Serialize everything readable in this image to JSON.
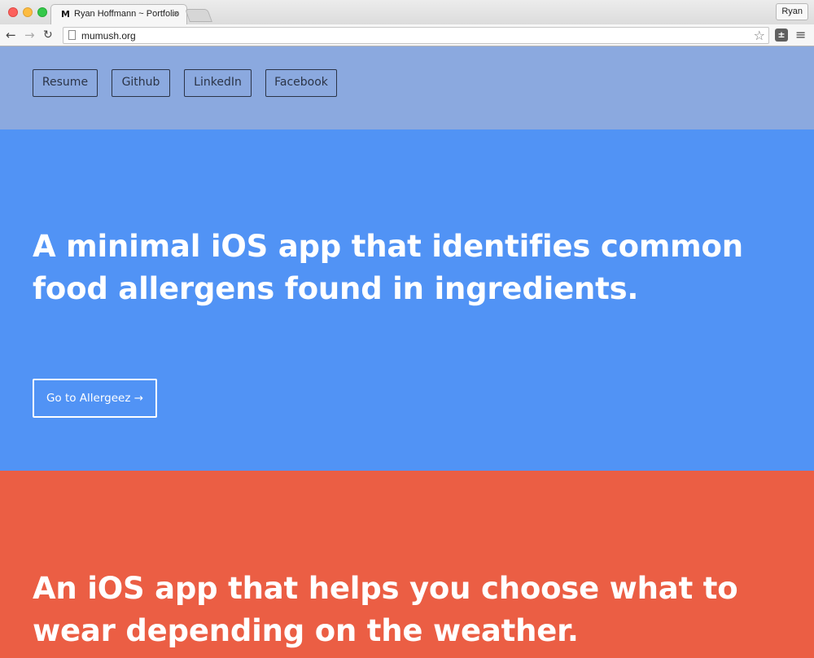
{
  "browser": {
    "tab_title": "Ryan Hoffmann ~ Portfolio",
    "tab_favicon": "M",
    "tab_close": "×",
    "profile_name": "Ryan",
    "url": "mumush.org",
    "icons": {
      "back": "back-arrow-icon",
      "forward": "forward-arrow-icon",
      "reload": "reload-icon",
      "page": "page-icon",
      "bookmark": "star-icon",
      "extension": "extension-icon",
      "menu": "hamburger-menu-icon"
    }
  },
  "nav": {
    "links": [
      {
        "label": "Resume"
      },
      {
        "label": "Github"
      },
      {
        "label": "LinkedIn"
      },
      {
        "label": "Facebook"
      }
    ]
  },
  "sections": [
    {
      "headline_line1": "A minimal iOS app that identifies common",
      "headline_line2": "food allergens found in ingredients.",
      "cta_label": "Go to Allergeez →",
      "background": "#5193f5"
    },
    {
      "headline_line1": "An iOS app that helps you choose what to",
      "headline_line2": "wear depending on the weather.",
      "background": "#eb5e44"
    }
  ],
  "colors": {
    "nav_background": "#8ba9df",
    "nav_text": "#2b3447",
    "headline_text": "#ffffff"
  }
}
